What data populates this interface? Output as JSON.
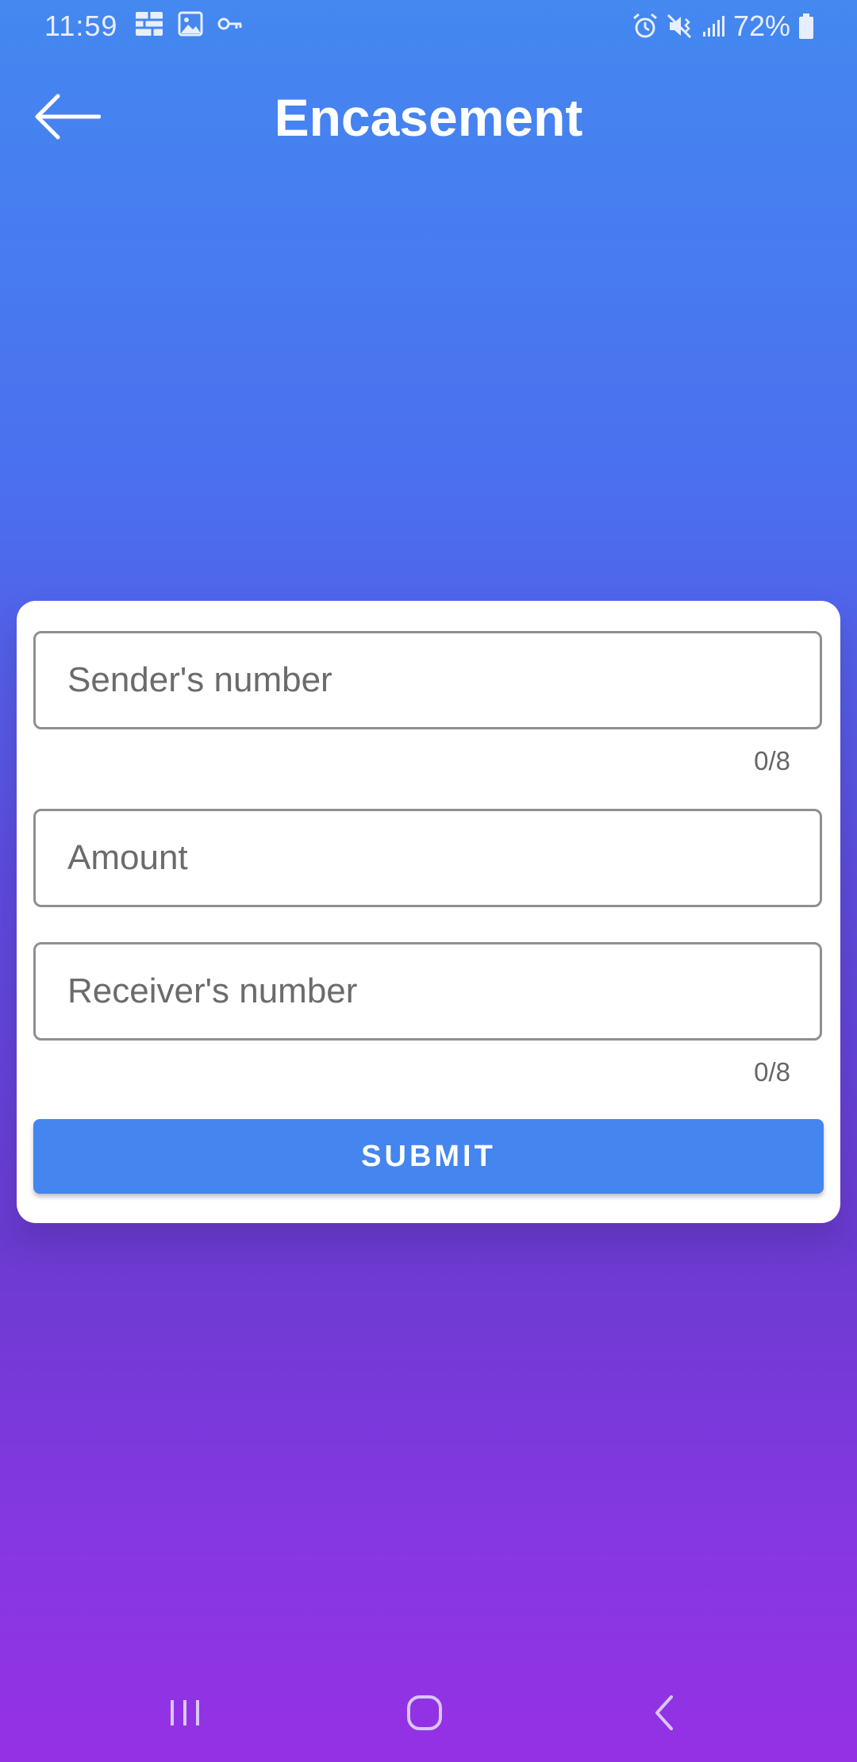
{
  "status_bar": {
    "time": "11:59",
    "battery": "72%",
    "left_icons": [
      "grid-icon",
      "image-icon",
      "key-icon"
    ],
    "right_icons": [
      "alarm-icon",
      "mute-vibrate-icon",
      "signal-icon",
      "battery-icon"
    ]
  },
  "app_bar": {
    "title": "Encasement",
    "back_icon": "arrow-left-icon"
  },
  "form": {
    "sender": {
      "placeholder": "Sender's number",
      "value": "",
      "counter": "0/8"
    },
    "amount": {
      "placeholder": "Amount",
      "value": ""
    },
    "receiver": {
      "placeholder": "Receiver's number",
      "value": "",
      "counter": "0/8"
    },
    "submit_label": "SUBMIT"
  },
  "nav_bar": {
    "recents_icon": "recents-icon",
    "home_icon": "home-icon",
    "back_icon": "back-chevron-icon"
  },
  "colors": {
    "gradient_top": "#4488f0",
    "gradient_bottom": "#9431e4",
    "button": "#4485ef",
    "card": "#ffffff"
  }
}
